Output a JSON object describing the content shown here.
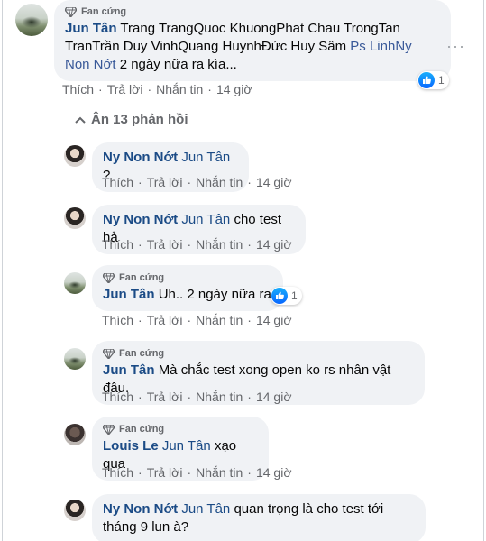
{
  "top_comment": {
    "badge": "Fan cứng",
    "author": "Jun Tân",
    "tagged_plain": "Trang TrangQuoc KhuongPhat Chau TrongTan TranTrần Duy VinhQuang HuynhĐức Huy Sâm",
    "tagged_link": "Ps LinhNy Non Nớt",
    "text": "2 ngày nữa ra kìa...",
    "actions": {
      "like": "Thích",
      "reply": "Trả lời",
      "message": "Nhắn tin",
      "time": "14 giờ"
    },
    "reaction_count": "1",
    "more": "···"
  },
  "hide_replies_label": "Ân 13 phản hồi",
  "replies": [
    {
      "badge": "",
      "author": "Ny Non Nớt",
      "mention": "Jun Tân",
      "text": "?",
      "time": "14 giờ"
    },
    {
      "badge": "",
      "author": "Ny Non Nớt",
      "mention": "Jun Tân",
      "text": "cho test hả",
      "time": "14 giờ"
    },
    {
      "badge": "Fan cứng",
      "author": "Jun Tân",
      "mention": "",
      "text": "Uh.. 2 ngày nữa ra",
      "time": "14 giờ",
      "reaction_count": "1"
    },
    {
      "badge": "Fan cứng",
      "author": "Jun Tân",
      "mention": "",
      "text": "Mà chắc test xong open ko rs nhân vật đâu.",
      "time": "14 giờ"
    },
    {
      "badge": "Fan cứng",
      "author": "Louis Le",
      "mention": "Jun Tân",
      "text": "xạo qua",
      "time": "14 giờ"
    },
    {
      "badge": "",
      "author": "Ny Non Nớt",
      "mention": "Jun Tân",
      "text": "quan trọng là cho test tới tháng 9 lun à?",
      "time": ""
    }
  ],
  "action_labels": {
    "like": "Thích",
    "reply": "Trả lời",
    "message": "Nhắn tin"
  },
  "colors": {
    "author": "#1b4b86",
    "muted": "#65676b",
    "bubble": "#f0f2f5",
    "like": "#0866ff"
  }
}
